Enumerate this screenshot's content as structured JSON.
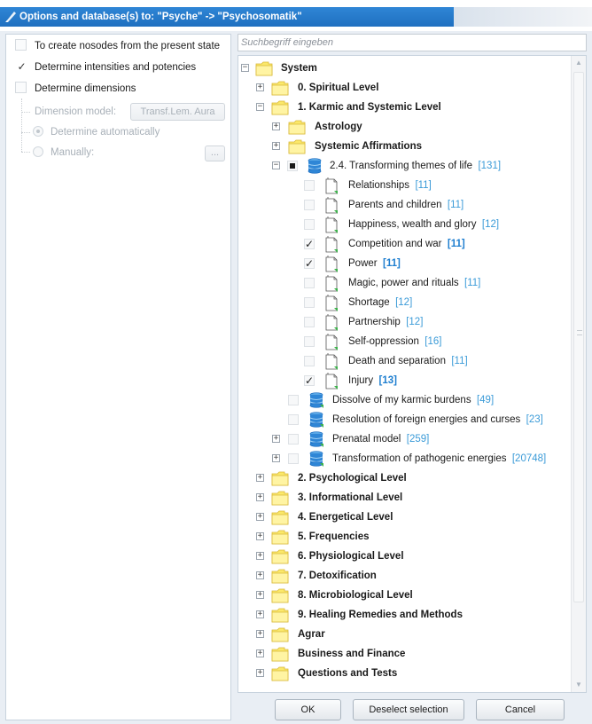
{
  "window": {
    "title": "Options and database(s) to: \"Psyche\" -> \"Psychosomatik\""
  },
  "options": {
    "create_nosodes": {
      "label": "To create nosodes from the present state",
      "checked": false
    },
    "determine_intensities": {
      "label": "Determine intensities and potencies",
      "checked": true
    },
    "determine_dimensions": {
      "label": "Determine dimensions",
      "checked": false
    },
    "dimension_model_label": "Dimension model:",
    "dimension_model_value": "Transf.Lem. Aura",
    "determine_automatically": "Determine automatically",
    "manually": "Manually:",
    "manually_button": "..."
  },
  "search": {
    "placeholder": "Suchbegriff eingeben"
  },
  "tree": {
    "root": "System",
    "level0": "0. Spiritual Level",
    "level1": "1. Karmic and Systemic Level",
    "astrology": "Astrology",
    "affirmations": "Systemic Affirmations",
    "themes": {
      "label": "2.4. Transforming themes of life",
      "count": "[131]"
    },
    "themes_items": [
      {
        "label": "Relationships",
        "count": "[11]",
        "checked": false
      },
      {
        "label": "Parents and children",
        "count": "[11]",
        "checked": false
      },
      {
        "label": "Happiness, wealth and glory",
        "count": "[12]",
        "checked": false
      },
      {
        "label": "Competition and war",
        "count": "[11]",
        "checked": true
      },
      {
        "label": "Power",
        "count": "[11]",
        "checked": true
      },
      {
        "label": "Magic, power and rituals",
        "count": "[11]",
        "checked": false
      },
      {
        "label": "Shortage",
        "count": "[12]",
        "checked": false
      },
      {
        "label": "Partnership",
        "count": "[12]",
        "checked": false
      },
      {
        "label": "Self-oppression",
        "count": "[16]",
        "checked": false
      },
      {
        "label": "Death and separation",
        "count": "[11]",
        "checked": false
      },
      {
        "label": "Injury",
        "count": "[13]",
        "checked": true
      }
    ],
    "dbs": [
      {
        "label": "Dissolve of my karmic burdens",
        "count": "[49]"
      },
      {
        "label": "Resolution of foreign energies and curses",
        "count": "[23]"
      },
      {
        "label": "Prenatal model",
        "count": "[259]"
      },
      {
        "label": "Transformation of pathogenic energies",
        "count": "[20748]"
      }
    ],
    "levels": [
      "2. Psychological Level",
      "3. Informational Level",
      "4. Energetical Level",
      "5. Frequencies",
      "6. Physiological Level",
      "7. Detoxification",
      "8. Microbiological Level",
      "9. Healing Remedies and Methods",
      "Agrar",
      "Business and Finance",
      "Questions and Tests"
    ]
  },
  "buttons": {
    "ok": "OK",
    "deselect": "Deselect selection",
    "cancel": "Cancel"
  },
  "colors": {
    "titlebar": "#1f6fc0",
    "count_blue": "#3b9bd8",
    "folder_yellow": "#fbe86a",
    "db_blue": "#2f86d6"
  }
}
